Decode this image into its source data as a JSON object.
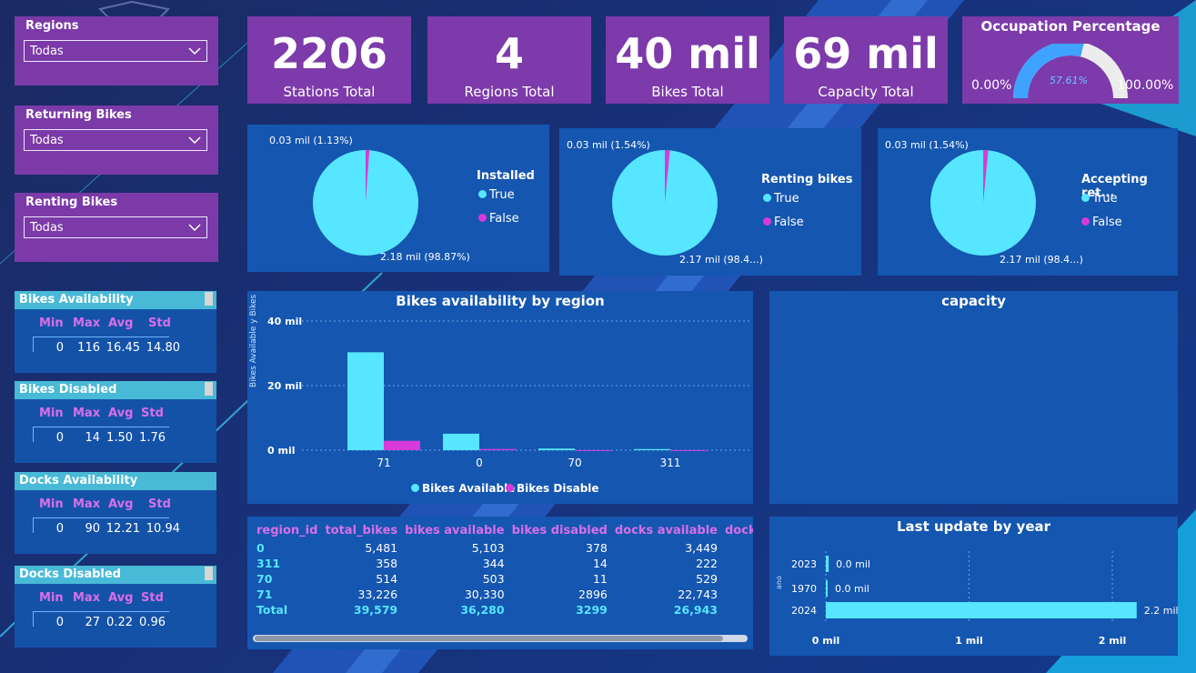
{
  "colors": {
    "cyan": "#56e6ff",
    "magenta": "#d63ad8",
    "card": "#7c3aaa",
    "panel": "#1456b0"
  },
  "slicers": [
    {
      "label": "Regions",
      "value": "Todas"
    },
    {
      "label": "Returning Bikes",
      "value": "Todas"
    },
    {
      "label": "Renting Bikes",
      "value": "Todas"
    }
  ],
  "kpis": [
    {
      "value": "2206",
      "label": "Stations Total"
    },
    {
      "value": "4",
      "label": "Regions Total"
    },
    {
      "value": "40 mil",
      "label": "Bikes Total"
    },
    {
      "value": "69 mil",
      "label": "Capacity Total"
    }
  ],
  "gauge": {
    "title": "Occupation Percentage",
    "min": "0.00%",
    "max": "100.00%",
    "value_label": "57.61%",
    "value": 0.5761
  },
  "pies": [
    {
      "legend_title": "Installed",
      "legend": [
        "True",
        "False"
      ],
      "small_label": "0.03 mil (1.13%)",
      "big_label": "2.18 mil (98.87%)",
      "false_fraction": 0.0113
    },
    {
      "legend_title": "Renting bikes",
      "legend": [
        "True",
        "False"
      ],
      "small_label": "0.03 mil (1.54%)",
      "big_label": "2.17 mil (98.4...)",
      "false_fraction": 0.0154
    },
    {
      "legend_title": "Accepting ret...",
      "legend": [
        "True",
        "False"
      ],
      "small_label": "0.03 mil (1.54%)",
      "big_label": "2.17 mil (98.4...)",
      "false_fraction": 0.0154
    }
  ],
  "stats": [
    {
      "title": "Bikes Availability",
      "headers": [
        "Min",
        "Max",
        "Avg",
        "Std"
      ],
      "values": [
        "0",
        "116",
        "16.45",
        "14.80"
      ]
    },
    {
      "title": "Bikes Disabled",
      "headers": [
        "Min",
        "Max",
        "Avg",
        "Std"
      ],
      "values": [
        "0",
        "14",
        "1.50",
        "1.76"
      ]
    },
    {
      "title": "Docks Availability",
      "headers": [
        "Min",
        "Max",
        "Avg",
        "Std"
      ],
      "values": [
        "0",
        "90",
        "12.21",
        "10.94"
      ]
    },
    {
      "title": "Docks Disabled",
      "headers": [
        "Min",
        "Max",
        "Avg",
        "Std"
      ],
      "values": [
        "0",
        "27",
        "0.22",
        "0.96"
      ]
    }
  ],
  "bar_chart": {
    "title": "Bikes availability by region",
    "ylabel": "Bikes Available y Bikes Dis...",
    "yticks": [
      "40 mil",
      "20 mil",
      "0 mil"
    ],
    "legend": [
      "Bikes Available",
      "Bikes Disable"
    ]
  },
  "capacity": {
    "title": "capacity"
  },
  "table": {
    "headers": [
      "region_id",
      "total_bikes",
      "bikes available",
      "bikes disabled",
      "docks available",
      "docks disab"
    ],
    "rows": [
      [
        "0",
        "5,481",
        "5,103",
        "378",
        "3,449"
      ],
      [
        "311",
        "358",
        "344",
        "14",
        "222"
      ],
      [
        "70",
        "514",
        "503",
        "11",
        "529"
      ],
      [
        "71",
        "33,226",
        "30,330",
        "2896",
        "22,743"
      ]
    ],
    "total": [
      "Total",
      "39,579",
      "36,280",
      "3299",
      "26,943"
    ]
  },
  "year_chart": {
    "title": "Last update by year",
    "xticks": [
      "0 mil",
      "1 mil",
      "2 mil"
    ],
    "ylabel": "ano"
  },
  "chart_data": [
    {
      "type": "bar",
      "title": "Bikes availability by region",
      "categories": [
        "71",
        "0",
        "70",
        "311"
      ],
      "series": [
        {
          "name": "Bikes Available",
          "values": [
            30330,
            5103,
            503,
            344
          ]
        },
        {
          "name": "Bikes Disable",
          "values": [
            2896,
            378,
            11,
            14
          ]
        }
      ],
      "ylim": [
        0,
        40000
      ]
    },
    {
      "type": "bar",
      "title": "Last update by year",
      "categories": [
        "2023",
        "1970",
        "2024"
      ],
      "series": [
        {
          "values": [
            20,
            10,
            2170
          ]
        }
      ],
      "data_labels": [
        "0.0 mil",
        "0.0 mil",
        "2.2 mil"
      ],
      "xlim": [
        0,
        2400
      ]
    }
  ]
}
